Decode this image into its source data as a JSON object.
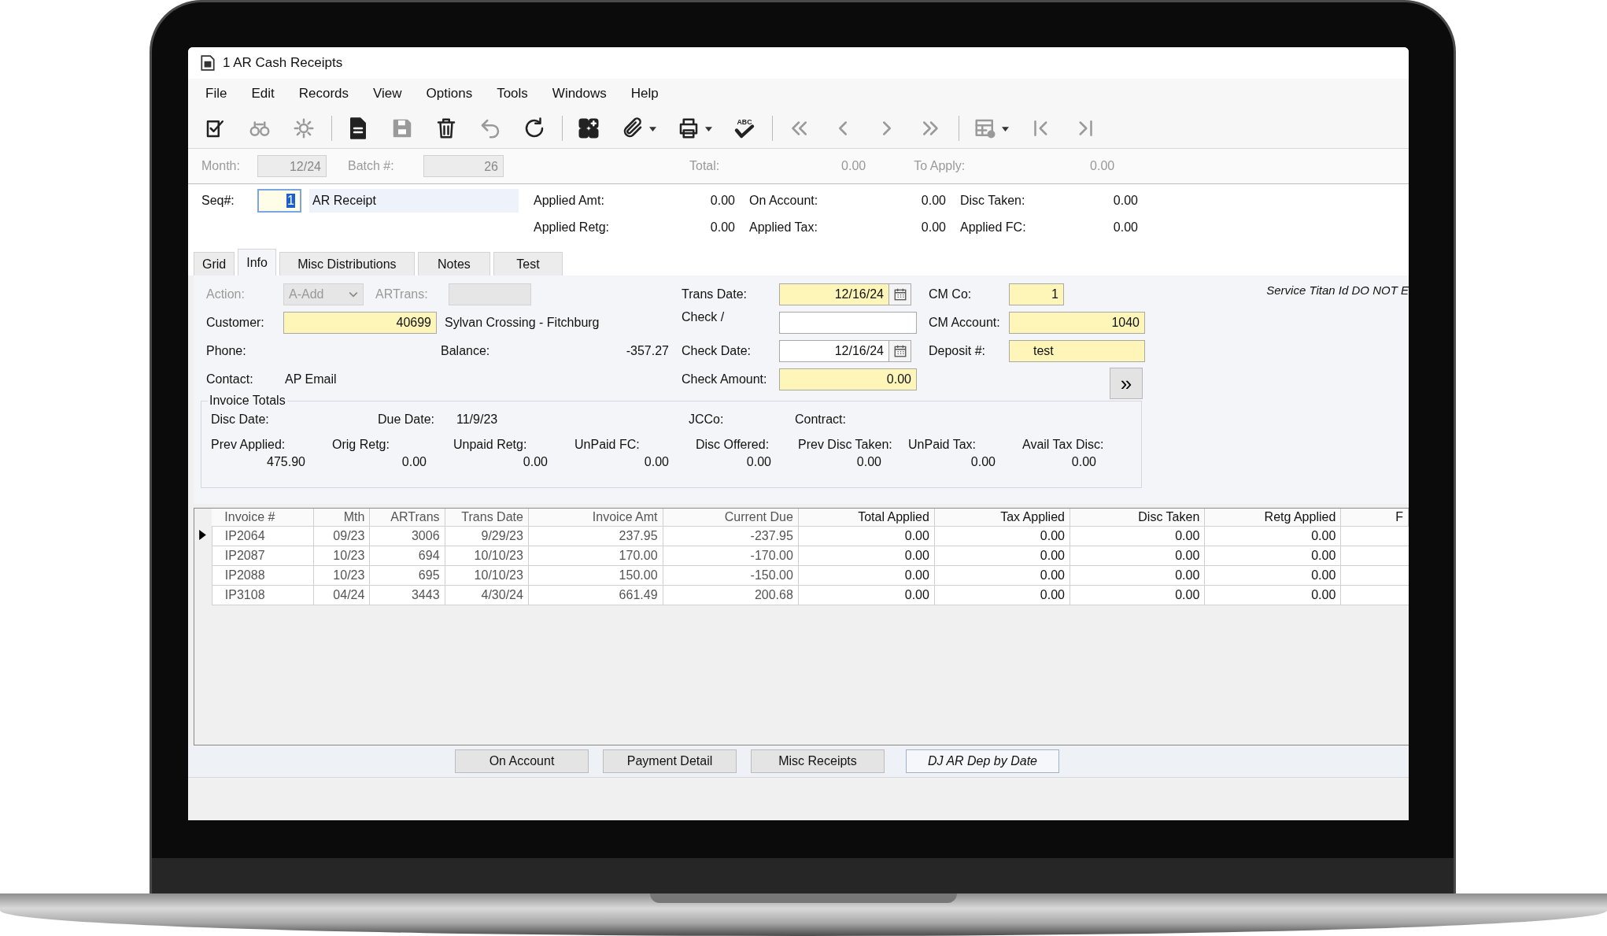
{
  "window": {
    "title": "1 AR Cash Receipts"
  },
  "menu": [
    "File",
    "Edit",
    "Records",
    "View",
    "Options",
    "Tools",
    "Windows",
    "Help"
  ],
  "toolbar": [
    {
      "kind": "edit",
      "disabled": false,
      "dropdown": false
    },
    {
      "kind": "find",
      "disabled": true,
      "dropdown": false
    },
    {
      "kind": "gear",
      "disabled": true,
      "dropdown": false
    },
    {
      "kind": "separator"
    },
    {
      "kind": "new",
      "disabled": false,
      "dropdown": false
    },
    {
      "kind": "save",
      "disabled": true,
      "dropdown": false
    },
    {
      "kind": "delete",
      "disabled": false,
      "dropdown": false
    },
    {
      "kind": "undo",
      "disabled": true,
      "dropdown": false
    },
    {
      "kind": "refresh",
      "disabled": false,
      "dropdown": false
    },
    {
      "kind": "separator"
    },
    {
      "kind": "grid",
      "disabled": false,
      "dropdown": false
    },
    {
      "kind": "attach",
      "disabled": false,
      "dropdown": true
    },
    {
      "kind": "print",
      "disabled": false,
      "dropdown": true
    },
    {
      "kind": "spell",
      "disabled": false,
      "dropdown": false,
      "label": "ABC"
    },
    {
      "kind": "separator"
    },
    {
      "kind": "first",
      "disabled": true,
      "dropdown": false
    },
    {
      "kind": "prev",
      "disabled": true,
      "dropdown": false
    },
    {
      "kind": "next",
      "disabled": true,
      "dropdown": false
    },
    {
      "kind": "last",
      "disabled": true,
      "dropdown": false
    },
    {
      "kind": "separator"
    },
    {
      "kind": "table",
      "disabled": true,
      "dropdown": true
    },
    {
      "kind": "start",
      "disabled": true,
      "dropdown": false
    },
    {
      "kind": "end",
      "disabled": true,
      "dropdown": false
    }
  ],
  "header": {
    "month": {
      "label": "Month:",
      "value": "12/24"
    },
    "batch": {
      "label": "Batch #:",
      "value": "26"
    },
    "total": {
      "label": "Total:",
      "value": "0.00"
    },
    "to_apply": {
      "label": "To Apply:",
      "value": "0.00"
    }
  },
  "receipt": {
    "seq_label": "Seq#:",
    "seq": "1",
    "type": "AR Receipt",
    "amounts": [
      {
        "label": "Applied Amt:",
        "value": "0.00"
      },
      {
        "label": "On Account:",
        "value": "0.00"
      },
      {
        "label": "Disc Taken:",
        "value": "0.00"
      },
      {
        "label": "Applied Retg:",
        "value": "0.00"
      },
      {
        "label": "Applied Tax:",
        "value": "0.00"
      },
      {
        "label": "Applied FC:",
        "value": "0.00"
      }
    ]
  },
  "tabs": [
    {
      "label": "Grid",
      "selected": false
    },
    {
      "label": "Info",
      "selected": true
    },
    {
      "label": "Misc Distributions",
      "selected": false
    },
    {
      "label": "Notes",
      "selected": false
    },
    {
      "label": "Test",
      "selected": false
    }
  ],
  "info": {
    "action": {
      "label": "Action:",
      "value": "A-Add",
      "disabled": true
    },
    "artrans": {
      "label": "ARTrans:",
      "disabled": true
    },
    "customer": {
      "label": "Customer:",
      "value": "40699",
      "name": "Sylvan Crossing - Fitchburg",
      "required": true
    },
    "phone": {
      "label": "Phone:"
    },
    "balance": {
      "label": "Balance:",
      "value": "-357.27"
    },
    "contact": {
      "label": "Contact:",
      "value": "AP Email"
    },
    "trans_date": {
      "label": "Trans Date:",
      "value": "12/16/24",
      "required": true
    },
    "check": {
      "label": "Check /",
      "required": false
    },
    "check_date": {
      "label": "Check Date:",
      "value": "12/16/24",
      "required": false
    },
    "check_amount": {
      "label": "Check Amount:",
      "value": "0.00",
      "required": true
    },
    "cm_co": {
      "label": "CM Co:",
      "value": "1",
      "required": true
    },
    "cm_account": {
      "label": "CM Account:",
      "value": "1040",
      "required": true
    },
    "deposit": {
      "label": "Deposit #:",
      "value": "test",
      "required": true
    },
    "more_button": "»",
    "note": "Service Titan Id DO NOT E"
  },
  "totals": {
    "title": "Invoice Totals",
    "disc_date": {
      "label": "Disc Date:"
    },
    "due_date": {
      "label": "Due Date:",
      "value": "11/9/23"
    },
    "jcco": {
      "label": "JCCo:"
    },
    "contract": {
      "label": "Contract:"
    },
    "columns": [
      {
        "label": "Prev Applied:",
        "value": "475.90"
      },
      {
        "label": "Orig Retg:",
        "value": "0.00"
      },
      {
        "label": "Unpaid Retg:",
        "value": "0.00"
      },
      {
        "label": "UnPaid FC:",
        "value": "0.00"
      },
      {
        "label": "Disc Offered:",
        "value": "0.00"
      },
      {
        "label": "Prev Disc Taken:",
        "value": "0.00"
      },
      {
        "label": "UnPaid Tax:",
        "value": "0.00"
      },
      {
        "label": "Avail Tax Disc:",
        "value": "0.00"
      }
    ]
  },
  "grid": {
    "columns": [
      {
        "label": "Invoice #",
        "editable": false
      },
      {
        "label": "Mth",
        "editable": false
      },
      {
        "label": "ARTrans",
        "editable": false
      },
      {
        "label": "Trans Date",
        "editable": false
      },
      {
        "label": "Invoice Amt",
        "editable": false
      },
      {
        "label": "Current Due",
        "editable": false
      },
      {
        "label": "Total Applied",
        "editable": true
      },
      {
        "label": "Tax Applied",
        "editable": true
      },
      {
        "label": "Disc Taken",
        "editable": true
      },
      {
        "label": "Retg Applied",
        "editable": true
      },
      {
        "label": "F",
        "editable": true
      }
    ],
    "rows": [
      {
        "selected": true,
        "cells": [
          "IP2064",
          "09/23",
          "3006",
          "9/29/23",
          "237.95",
          "-237.95",
          "0.00",
          "0.00",
          "0.00",
          "0.00"
        ]
      },
      {
        "selected": false,
        "cells": [
          "IP2087",
          "10/23",
          "694",
          "10/10/23",
          "170.00",
          "-170.00",
          "0.00",
          "0.00",
          "0.00",
          "0.00"
        ]
      },
      {
        "selected": false,
        "cells": [
          "IP2088",
          "10/23",
          "695",
          "10/10/23",
          "150.00",
          "-150.00",
          "0.00",
          "0.00",
          "0.00",
          "0.00"
        ]
      },
      {
        "selected": false,
        "cells": [
          "IP3108",
          "04/24",
          "3443",
          "4/30/24",
          "661.49",
          "200.68",
          "0.00",
          "0.00",
          "0.00",
          "0.00"
        ]
      }
    ]
  },
  "buttons": [
    {
      "label": "On Account",
      "kind": "standard"
    },
    {
      "label": "Payment Detail",
      "kind": "standard"
    },
    {
      "label": "Misc Receipts",
      "kind": "standard"
    },
    {
      "label": "DJ AR Dep by Date",
      "kind": "custom"
    }
  ]
}
